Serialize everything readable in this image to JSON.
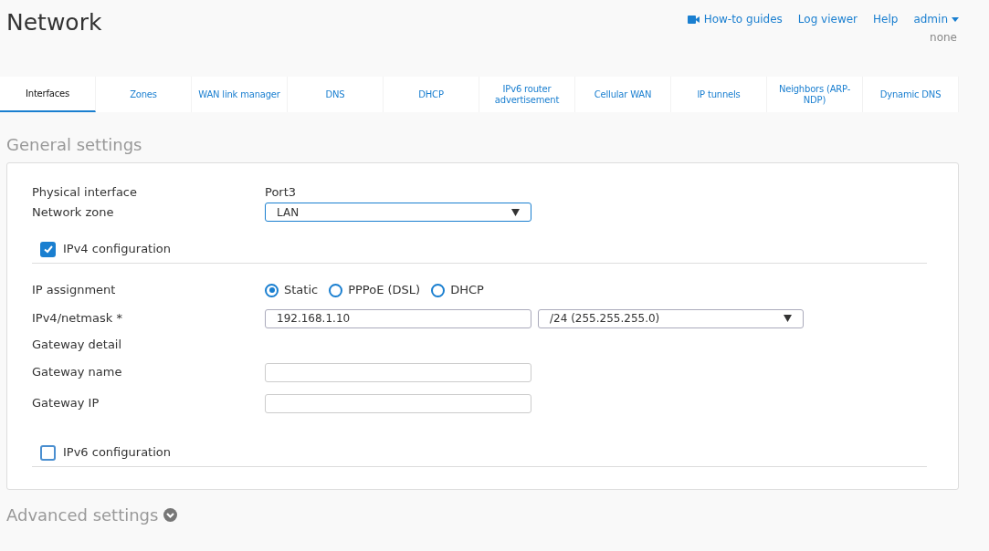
{
  "title": "Network",
  "top_links": [
    {
      "label": "How-to guides",
      "kind": "video"
    },
    {
      "label": "Log viewer",
      "kind": "plain"
    },
    {
      "label": "Help",
      "kind": "plain"
    }
  ],
  "user": {
    "name": "admin",
    "org": "none"
  },
  "tabs": [
    {
      "label": "Interfaces",
      "selected": true
    },
    {
      "label": "Zones",
      "selected": false
    },
    {
      "label": "WAN link manager",
      "selected": false
    },
    {
      "label": "DNS",
      "selected": false
    },
    {
      "label": "DHCP",
      "selected": false
    },
    {
      "label": "IPv6 router advertisement",
      "selected": false
    },
    {
      "label": "Cellular WAN",
      "selected": false
    },
    {
      "label": "IP tunnels",
      "selected": false
    },
    {
      "label": "Neighbors (ARP-NDP)",
      "selected": false
    },
    {
      "label": "Dynamic DNS",
      "selected": false
    }
  ],
  "general_settings": {
    "heading": "General settings",
    "rows": [
      {
        "kind": "static",
        "label": "Physical interface",
        "value": "Port3"
      },
      {
        "kind": "select",
        "label": "Network zone",
        "value": "LAN"
      },
      {
        "kind": "checkbox",
        "label": "IPv4 configuration",
        "checked": true
      },
      {
        "kind": "divider"
      },
      {
        "kind": "radio",
        "label": "IP assignment",
        "options": [
          {
            "label": "Static",
            "selected": true
          },
          {
            "label": "PPPoE (DSL)",
            "selected": false
          },
          {
            "label": "DHCP",
            "selected": false
          }
        ]
      },
      {
        "kind": "ipmask",
        "label": "IPv4/netmask *",
        "value": "192.168.1.10",
        "mask": "/24 (255.255.255.0)"
      },
      {
        "kind": "heading",
        "label": "Gateway detail"
      },
      {
        "kind": "input",
        "label": "Gateway name",
        "value": ""
      },
      {
        "kind": "input",
        "label": "Gateway IP",
        "value": ""
      },
      {
        "kind": "spacer"
      },
      {
        "kind": "checkbox",
        "label": "IPv6 configuration",
        "checked": false
      },
      {
        "kind": "divider"
      }
    ]
  },
  "advanced_settings": {
    "heading": "Advanced settings",
    "expanded": false
  }
}
